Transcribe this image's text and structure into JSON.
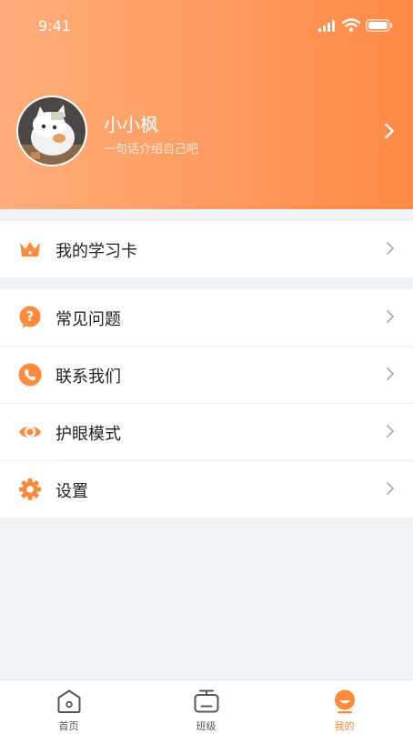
{
  "status_bar": {
    "time": "9:41"
  },
  "profile": {
    "name": "小小枫",
    "bio": "一句话介绍自己吧"
  },
  "menu": {
    "study_card": {
      "label": "我的学习卡",
      "icon": "crown-icon"
    },
    "items": [
      {
        "label": "常见问题",
        "icon": "question-icon"
      },
      {
        "label": "联系我们",
        "icon": "phone-icon"
      },
      {
        "label": "护眼模式",
        "icon": "eye-icon"
      },
      {
        "label": "设置",
        "icon": "gear-icon"
      }
    ]
  },
  "tabbar": {
    "tabs": [
      {
        "label": "首页",
        "icon": "home-icon",
        "active": false
      },
      {
        "label": "班级",
        "icon": "tv-icon",
        "active": false
      },
      {
        "label": "我的",
        "icon": "profile-icon",
        "active": true
      }
    ]
  },
  "colors": {
    "accent": "#ff8a3c",
    "header_start": "#ffae7c",
    "header_end": "#ff8a45"
  }
}
